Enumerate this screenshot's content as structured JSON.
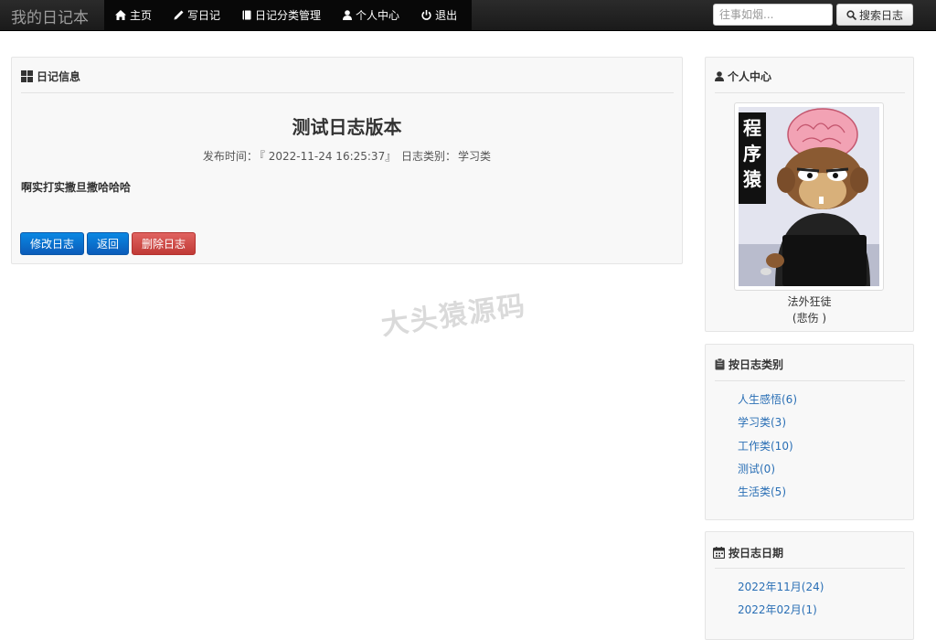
{
  "brand": "我的日记本",
  "nav": {
    "items": [
      {
        "label": "主页",
        "icon": "home-icon"
      },
      {
        "label": "写日记",
        "icon": "pencil-icon"
      },
      {
        "label": "日记分类管理",
        "icon": "book-icon"
      },
      {
        "label": "个人中心",
        "icon": "user-icon"
      },
      {
        "label": "退出",
        "icon": "power-icon"
      }
    ]
  },
  "search": {
    "placeholder": "往事如烟...",
    "button_label": "搜索日志"
  },
  "diary_panel": {
    "title": "日记信息",
    "diary_title": "测试日志版本",
    "publish_label": "发布时间：",
    "publish_time": "『 2022-11-24 16:25:37』",
    "category_label": "日志类别：",
    "category": "学习类",
    "content": "啊实打实撒旦撒哈哈哈",
    "buttons": {
      "edit": "修改日志",
      "back": "返回",
      "delete": "删除日志"
    }
  },
  "profile_panel": {
    "title": "个人中心",
    "avatar_text": "程序猿",
    "nickname": "法外狂徒",
    "mood": "(悲伤 )"
  },
  "category_panel": {
    "title": "按日志类别",
    "items": [
      "人生感悟(6)",
      "学习类(3)",
      "工作类(10)",
      "测试(0)",
      "生活类(5)"
    ]
  },
  "date_panel": {
    "title": "按日志日期",
    "items": [
      "2022年11月(24)",
      "2022年02月(1)"
    ]
  },
  "watermark": "大头猿源码",
  "colors": {
    "navbar": "#1a1a1a",
    "primary_button": "#0b6fcf",
    "danger_button": "#d9534f",
    "link": "#2a6fb5"
  }
}
